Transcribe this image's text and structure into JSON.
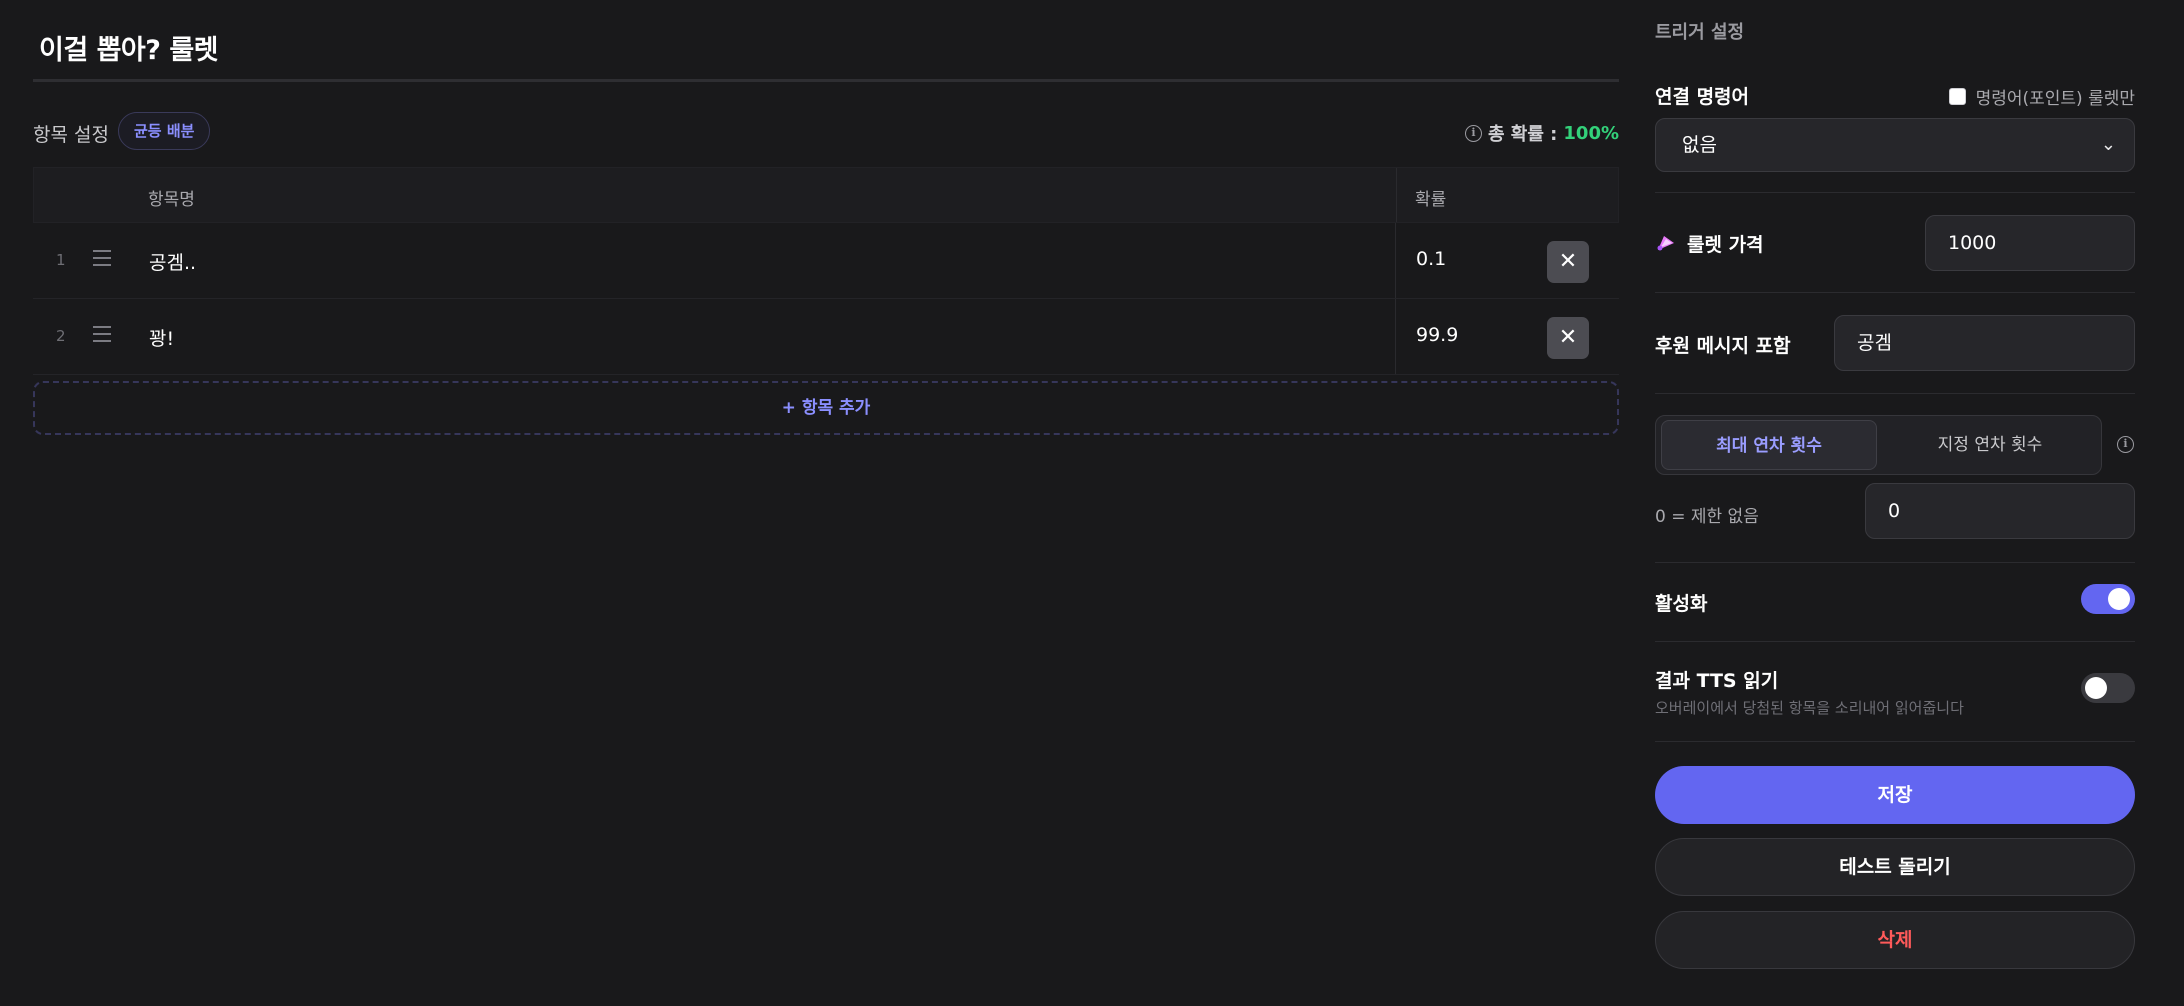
{
  "page": {
    "title": "이걸 뽑아? 룰렛"
  },
  "items_section": {
    "label": "항목 설정",
    "even_button": "균등 배분",
    "total_label": "총 확률 :",
    "total_value": "100%",
    "columns": {
      "name": "항목명",
      "probability": "확률"
    },
    "rows": [
      {
        "index": "1",
        "name": "공겜..",
        "probability": "0.1"
      },
      {
        "index": "2",
        "name": "꽝!",
        "probability": "99.9"
      }
    ],
    "add_button": "+ 항목 추가"
  },
  "trigger": {
    "section_title": "트리거 설정",
    "command_label": "연결 명령어",
    "command_only_label": "명령어(포인트) 룰렛만",
    "command_value": "없음",
    "price_label": "룰렛 가격",
    "price_value": "1000",
    "donation_label": "후원 메시지 포함",
    "donation_value": "공겜",
    "tab_max": "최대 연차 횟수",
    "tab_fixed": "지정 연차 횟수",
    "limit_hint": "0 = 제한 없음",
    "limit_value": "0",
    "active_label": "활성화",
    "active_on": true,
    "tts_label": "결과 TTS 읽기",
    "tts_desc": "오버레이에서 당첨된 항목을 소리내어 읽어줍니다",
    "tts_on": false
  },
  "actions": {
    "save": "저장",
    "test": "테스트 돌리기",
    "delete": "삭제"
  },
  "colors": {
    "accent": "#6366f1",
    "success": "#33d17a",
    "danger": "#ff5a5a",
    "background": "#19191b"
  }
}
